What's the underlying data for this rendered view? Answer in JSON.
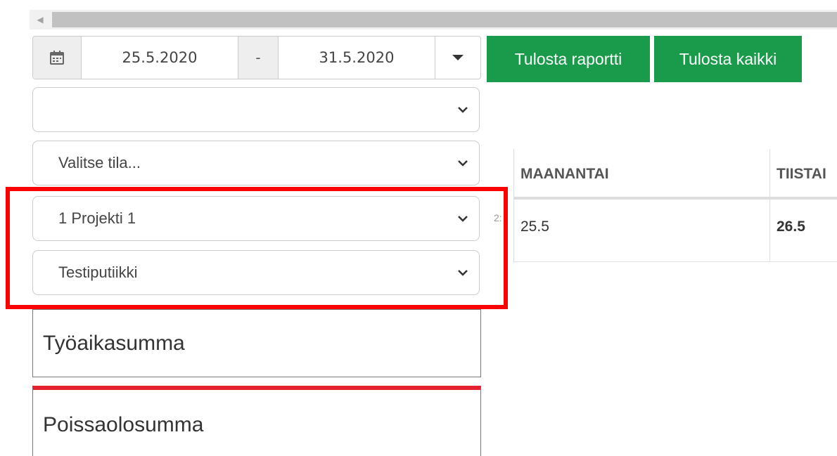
{
  "date_range": {
    "start": "25.5.2020",
    "separator": "-",
    "end": "31.5.2020"
  },
  "buttons": {
    "print_report": "Tulosta raportti",
    "print_all": "Tulosta kaikki"
  },
  "filters": {
    "select_1_value": "",
    "status_placeholder": "Valitse tila...",
    "project_value": "1 Projekti 1",
    "shop_value": "Testiputiikki"
  },
  "partial_label": "2:",
  "summaries": {
    "work_time": "Työaikasumma",
    "absence": "Poissaolosumma"
  },
  "week_table": {
    "headers": [
      "MAANANTAI",
      "TIISTAI"
    ],
    "dates": [
      "25.5",
      "26.5"
    ]
  },
  "colors": {
    "accent_green": "#1a9b4b",
    "highlight_red": "#ff0000",
    "absence_red": "#e5212f"
  },
  "icons": {
    "calendar": "calendar-icon",
    "dropdown": "chevron-down-icon",
    "caret": "caret-down-icon",
    "scroll_left": "scroll-left-arrow-icon"
  }
}
